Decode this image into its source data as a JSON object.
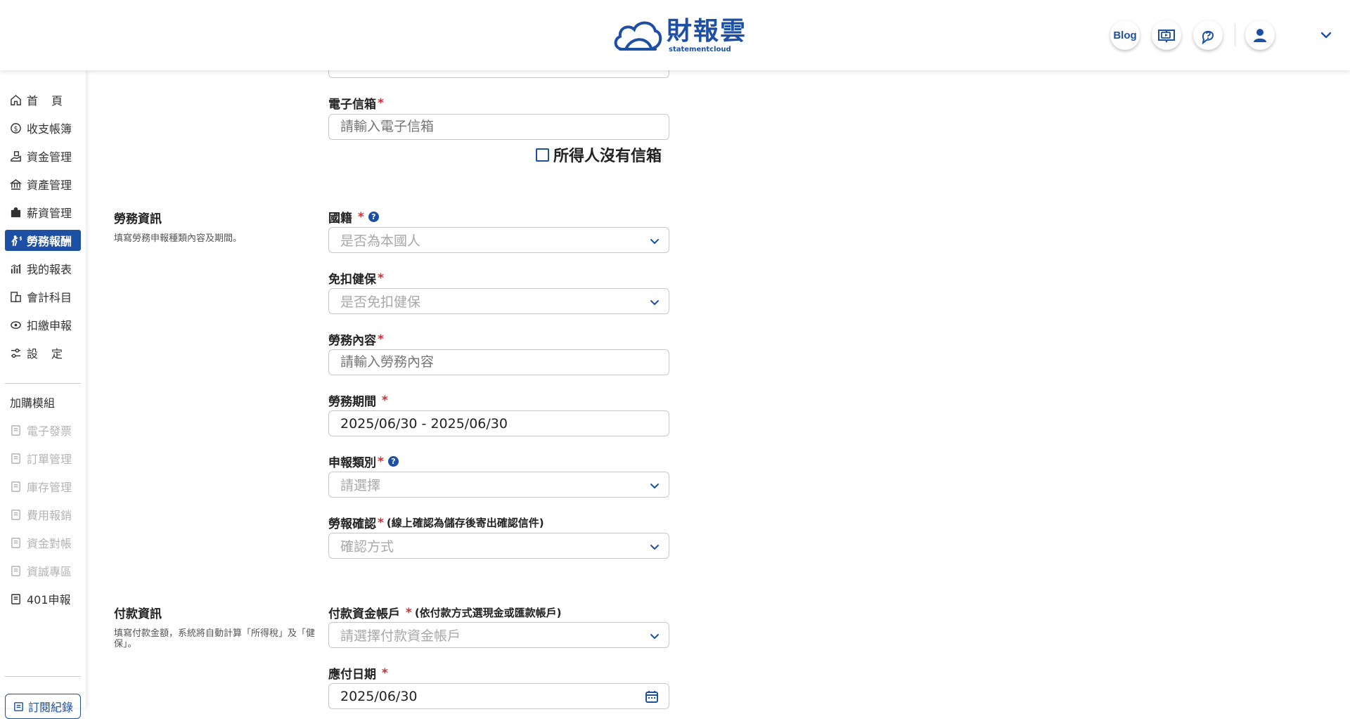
{
  "header": {
    "logo_cn": "財報雲",
    "logo_en": "statementcloud",
    "blog_label": "Blog"
  },
  "sidebar": {
    "items": [
      {
        "label": "首頁"
      },
      {
        "label": "收支帳簿"
      },
      {
        "label": "資金管理"
      },
      {
        "label": "資產管理"
      },
      {
        "label": "薪資管理"
      },
      {
        "label": "勞務報酬"
      },
      {
        "label": "我的報表"
      },
      {
        "label": "會計科目"
      },
      {
        "label": "扣繳申報"
      },
      {
        "label": "設定"
      }
    ],
    "addon_title": "加購模組",
    "addons": [
      {
        "label": "電子發票"
      },
      {
        "label": "訂單管理"
      },
      {
        "label": "庫存管理"
      },
      {
        "label": "費用報銷"
      },
      {
        "label": "資金對帳"
      },
      {
        "label": "資誠專區"
      },
      {
        "label": "401申報"
      }
    ],
    "subscription_label": "訂閱紀錄"
  },
  "form": {
    "email": {
      "label": "電子信箱",
      "placeholder": "請輸入電子信箱"
    },
    "no_email_label": "所得人沒有信箱",
    "labor_section": {
      "title": "勞務資訊",
      "desc": "填寫勞務申報種類內容及期間。"
    },
    "nationality": {
      "label": "國籍",
      "placeholder": "是否為本國人"
    },
    "health_exempt": {
      "label": "免扣健保",
      "placeholder": "是否免扣健保"
    },
    "labor_content": {
      "label": "勞務內容",
      "placeholder": "請輸入勞務內容"
    },
    "labor_period": {
      "label": "勞務期間",
      "value": "2025/06/30 - 2025/06/30"
    },
    "report_type": {
      "label": "申報類別",
      "placeholder": "請選擇"
    },
    "confirm": {
      "label": "勞報確認",
      "note": "(線上確認為儲存後寄出確認信件)",
      "placeholder": "確認方式"
    },
    "payment_section": {
      "title": "付款資訊",
      "desc": "填寫付款金額，系統將自動計算「所得稅」及「健保」。"
    },
    "pay_account": {
      "label": "付款資金帳戶",
      "note": "(依付款方式選現金或匯款帳戶)",
      "placeholder": "請選擇付款資金帳戶"
    },
    "due_date": {
      "label": "應付日期",
      "value": "2025/06/30"
    }
  },
  "colors": {
    "brand": "#1d4fa5",
    "required": "#e0292c"
  }
}
